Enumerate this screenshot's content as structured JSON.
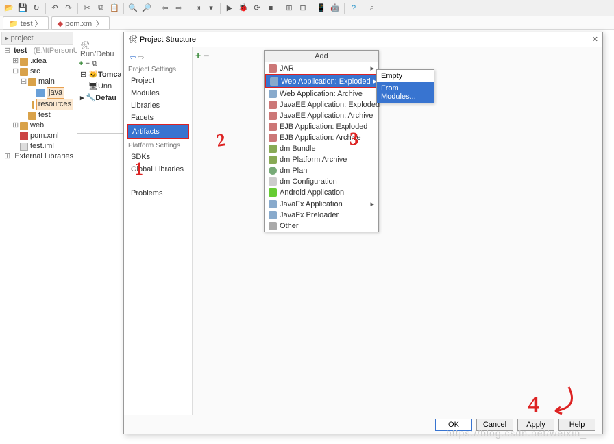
{
  "toolbar_icons": [
    "folder",
    "save",
    "undo",
    "redo",
    "cut",
    "copy",
    "paste",
    "find",
    "replace",
    "back",
    "fwd",
    "step",
    "config",
    "run",
    "debug",
    "sync",
    "stop",
    "edit-cfg",
    "struct",
    "tree",
    "db",
    "android",
    "bug",
    "help",
    "extra"
  ],
  "breadcrumb": {
    "root": "test",
    "file": "pom.xml"
  },
  "project_panel_title": "project",
  "tree": {
    "root": "test",
    "root_hint": "(E:\\ItPersonU",
    "idea": ".idea",
    "src": "src",
    "main": "main",
    "java": "java",
    "resources": "resources",
    "tst": "test",
    "web": "web",
    "pom": "pom.xml",
    "iml": "test.iml",
    "ext": "External Libraries"
  },
  "runcfg": {
    "title": "Run/Debu",
    "tomcat": "Tomca",
    "unn": "Unn",
    "defaults": "Defau"
  },
  "dialog": {
    "title": "Project Structure",
    "nav": {
      "hdr1": "Project Settings",
      "project": "Project",
      "modules": "Modules",
      "libraries": "Libraries",
      "facets": "Facets",
      "artifacts": "Artifacts",
      "hdr2": "Platform Settings",
      "sdks": "SDKs",
      "globlib": "Global Libraries",
      "problems": "Problems"
    },
    "add_title": "Add",
    "menu": {
      "jar": "JAR",
      "webexp": "Web Application: Exploded",
      "webarc": "Web Application: Archive",
      "jeeexp": "JavaEE Application: Exploded",
      "jeearc": "JavaEE Application: Archive",
      "ejbexp": "EJB Application: Exploded",
      "ejbarc": "EJB Application: Archive",
      "dmbundle": "dm Bundle",
      "dmplat": "dm Platform Archive",
      "dmplan": "dm Plan",
      "dmconf": "dm Configuration",
      "android": "Android Application",
      "jfxapp": "JavaFx Application",
      "jfxpre": "JavaFx Preloader",
      "other": "Other"
    },
    "submenu": {
      "empty": "Empty",
      "from": "From Modules..."
    },
    "buttons": {
      "ok": "OK",
      "cancel": "Cancel",
      "apply": "Apply",
      "help": "Help"
    }
  },
  "annotations": {
    "a1": "1",
    "a2": "2",
    "a3": "3",
    "a4": "4"
  },
  "watermark": "https://blog.csdn.net/weixin_"
}
